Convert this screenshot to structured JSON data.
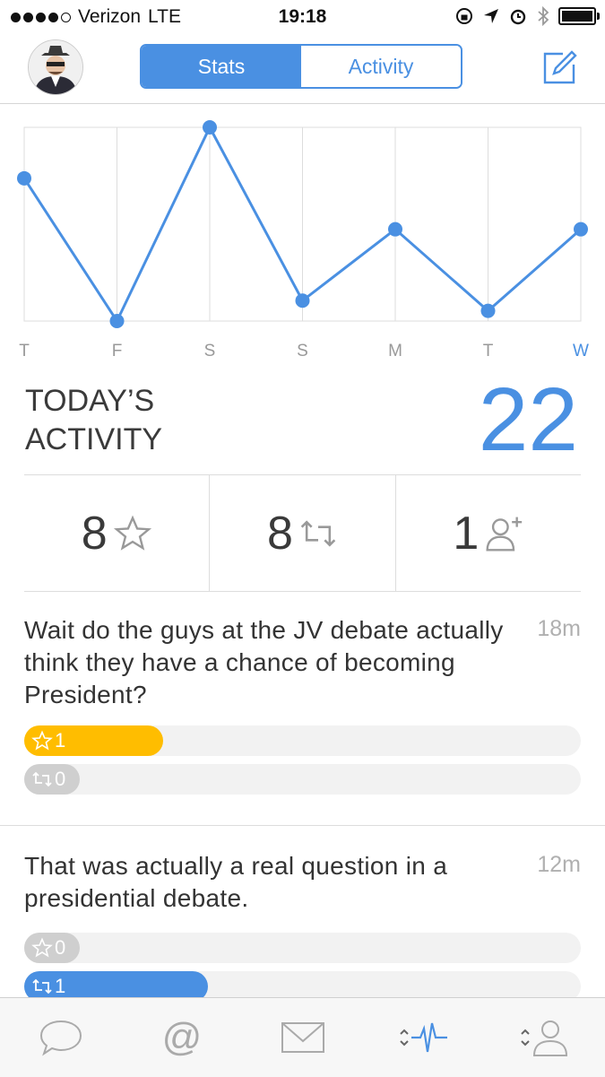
{
  "status_bar": {
    "carrier": "Verizon",
    "network": "LTE",
    "time": "19:18"
  },
  "nav": {
    "tabs": [
      "Stats",
      "Activity"
    ],
    "active_tab": "Stats"
  },
  "chart_data": {
    "type": "line",
    "categories": [
      "T",
      "F",
      "S",
      "S",
      "M",
      "T",
      "W"
    ],
    "values": [
      18,
      4,
      23,
      6,
      13,
      5,
      13
    ],
    "ylim": [
      4,
      23
    ],
    "grid": true,
    "accent_color": "#4a90e2"
  },
  "today": {
    "label_line1": "TODAY’S",
    "label_line2": "ACTIVITY",
    "value": "22"
  },
  "counts": {
    "favorites": "8",
    "retweets": "8",
    "followers": "1"
  },
  "tweets": [
    {
      "text": "Wait do the guys at the JV debate actually think they have a chance of becoming President?",
      "age": "18m",
      "favorites": "1",
      "retweets": "0",
      "favorite_fill": 0.25,
      "retweet_fill": 0
    },
    {
      "text": "That was actually a real question in a presidential debate.",
      "age": "12m",
      "favorites": "0",
      "retweets": "1",
      "favorite_fill": 0,
      "retweet_fill": 0.33
    }
  ],
  "colors": {
    "accent": "#4a90e2",
    "favorite": "#ffbd00",
    "inactive": "#cfcfcf"
  },
  "tab_bar": [
    "chat-bubble-icon",
    "mention-icon",
    "mail-icon",
    "activity-icon",
    "profile-icon"
  ]
}
